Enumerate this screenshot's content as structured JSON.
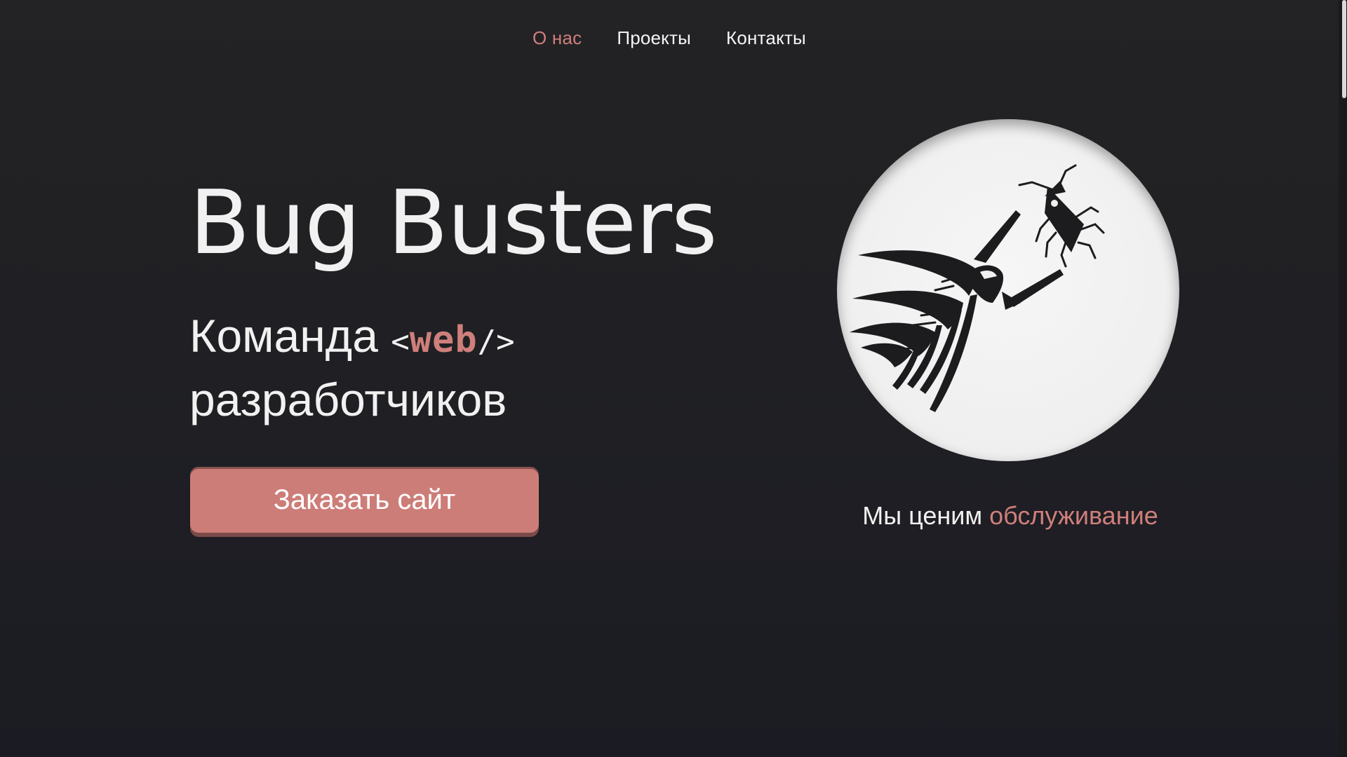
{
  "nav": {
    "items": [
      {
        "label": "О нас",
        "active": true
      },
      {
        "label": "Проекты",
        "active": false
      },
      {
        "label": "Контакты",
        "active": false
      }
    ]
  },
  "hero": {
    "title": "Bug Busters",
    "subtitle_prefix": "Команда",
    "code_open": "<",
    "code_word": "web",
    "code_close": "/>",
    "subtitle_suffix": "разработчиков",
    "order_button_label": "Заказать сайт"
  },
  "logo": {
    "icon": "swallow-catching-bug-icon"
  },
  "tagline": {
    "prefix": "Мы ценим",
    "accent": "обслуживание"
  },
  "colors": {
    "accent": "#cf7f7b",
    "background": "#202024",
    "button": "#cd7d78",
    "circle": "#f0f0f0"
  }
}
